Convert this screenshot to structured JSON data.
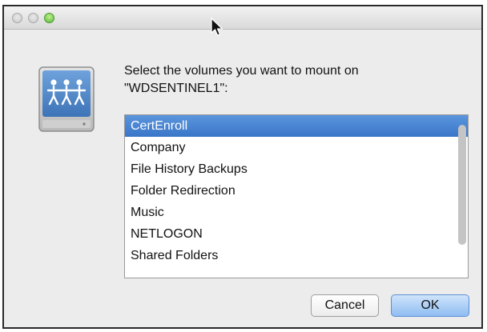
{
  "window": {
    "traffic_lights": [
      "close",
      "minimize",
      "zoom"
    ]
  },
  "icon": {
    "name": "network-volume-icon",
    "accent": "#4a86c8"
  },
  "dialog": {
    "prompt_line1": "Select the volumes you want to mount on",
    "prompt_line2": "\"WDSENTINEL1\":"
  },
  "volumes": {
    "items": [
      {
        "label": "CertEnroll",
        "selected": true
      },
      {
        "label": "Company",
        "selected": false
      },
      {
        "label": "File History Backups",
        "selected": false
      },
      {
        "label": "Folder Redirection",
        "selected": false
      },
      {
        "label": "Music",
        "selected": false
      },
      {
        "label": "NETLOGON",
        "selected": false
      },
      {
        "label": "Shared Folders",
        "selected": false
      }
    ]
  },
  "buttons": {
    "cancel_label": "Cancel",
    "ok_label": "OK"
  },
  "colors": {
    "selection": "#3a76c8",
    "default_button": "#8fbdf2",
    "zoom_light": "#57b83a"
  }
}
